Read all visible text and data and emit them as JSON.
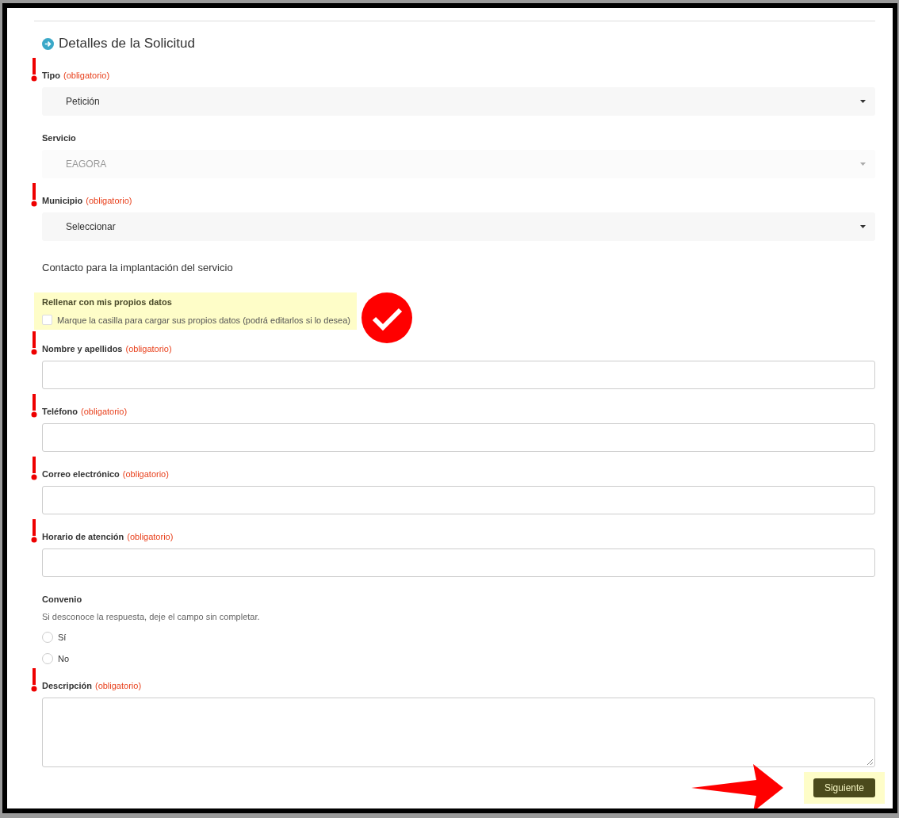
{
  "section": {
    "title": "Detalles de la Solicitud"
  },
  "fields": [
    {
      "kind": "select",
      "label": "Tipo",
      "required_text": "(obligatorio)",
      "flagged": true,
      "value": "Petición",
      "disabled": false
    },
    {
      "kind": "select",
      "label": "Servicio",
      "value": "EAGORA",
      "disabled": true
    },
    {
      "kind": "select",
      "label": "Municipio",
      "required_text": "(obligatorio)",
      "flagged": true,
      "value": "Seleccionar",
      "disabled": false
    },
    {
      "kind": "heading",
      "label": "Contacto para la implantación del servicio"
    },
    {
      "kind": "checkbox",
      "label": "Rellenar con mis propios datos",
      "option": "Marque la casilla para cargar sus propios datos (podrá editarlos si lo desea)",
      "checked": false,
      "highlighted": true,
      "approved": true
    },
    {
      "kind": "text",
      "label": "Nombre y apellidos",
      "required_text": "(obligatorio)",
      "flagged": true
    },
    {
      "kind": "text",
      "label": "Teléfono",
      "required_text": "(obligatorio)",
      "flagged": true
    },
    {
      "kind": "text",
      "label": "Correo electrónico",
      "required_text": "(obligatorio)",
      "flagged": true
    },
    {
      "kind": "text",
      "label": "Horario de atención",
      "required_text": "(obligatorio)",
      "flagged": true
    },
    {
      "kind": "radio",
      "label": "Convenio",
      "hint": "Si desconoce la respuesta, deje el campo sin completar.",
      "options": [
        {
          "label": "Sí",
          "selected": false
        },
        {
          "label": "No",
          "selected": false
        }
      ]
    },
    {
      "kind": "textarea",
      "label": "Descripción",
      "required_text": "(obligatorio)",
      "flagged": true
    }
  ],
  "next_button": {
    "label": "Siguiente",
    "highlighted": true,
    "pointed": true
  }
}
